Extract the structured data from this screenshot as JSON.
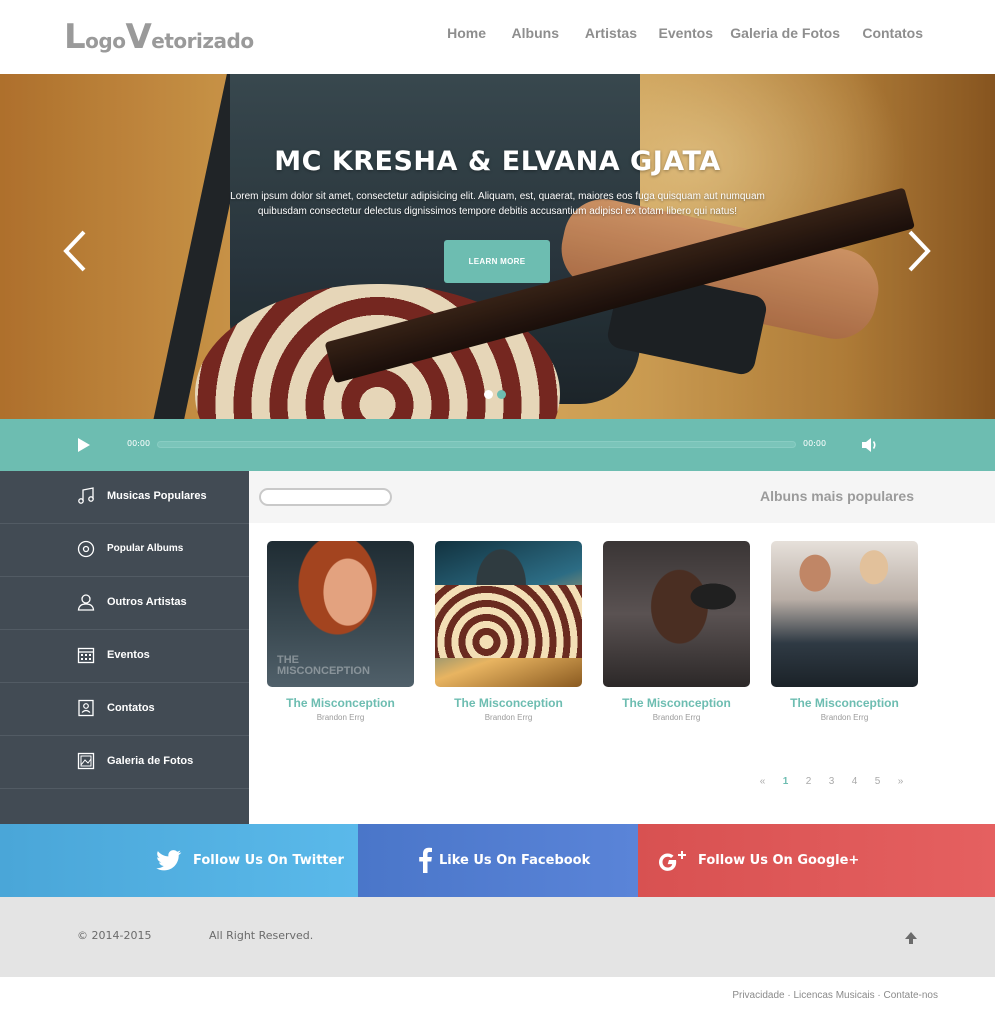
{
  "header": {
    "logo_cap1": "L",
    "logo_rest1": "ogo",
    "logo_cap2": "V",
    "logo_rest2": "etorizado",
    "nav": [
      "Home",
      "Albuns",
      "Artistas",
      "Eventos",
      "Galeria de Fotos",
      "Contatos"
    ]
  },
  "hero": {
    "title": "MC KRESHA & ELVANA GJATA",
    "text": "Lorem ipsum dolor sit amet, consectetur adipisicing elit. Aliquam, est, quaerat, maiores eos fuga quisquam aut numquam quibusdam consectetur delectus dignissimos tempore debitis accusantium adipisci ex totam libero qui natus!",
    "button": "LEARN MORE",
    "slide_count": 2,
    "active_slide": 2
  },
  "player": {
    "current_time": "00:00",
    "total_time": "00:00",
    "progress": 0
  },
  "sidebar": {
    "items": [
      {
        "label": "Musicas Populares",
        "icon": "music-note-icon"
      },
      {
        "label": "Popular Albums",
        "icon": "disc-icon"
      },
      {
        "label": "Outros Artistas",
        "icon": "user-icon"
      },
      {
        "label": "Eventos",
        "icon": "calendar-icon"
      },
      {
        "label": "Contatos",
        "icon": "address-book-icon"
      },
      {
        "label": "Galeria de Fotos",
        "icon": "image-icon"
      }
    ]
  },
  "main": {
    "search_placeholder": "",
    "section_title": "Albuns mais populares",
    "albums": [
      {
        "title": "The Misconception",
        "artist": "Brandon Errg",
        "watermark_line1": "THE",
        "watermark_line2": "MISCONCEPTION"
      },
      {
        "title": "The Misconception",
        "artist": "Brandon Errg"
      },
      {
        "title": "The Misconception",
        "artist": "Brandon Errg"
      },
      {
        "title": "The Misconception",
        "artist": "Brandon Errg"
      }
    ],
    "pagination": {
      "prev": "«",
      "pages": [
        "1",
        "2",
        "3",
        "4",
        "5"
      ],
      "next": "»",
      "active": "1"
    }
  },
  "social": {
    "twitter": "Follow Us On Twitter",
    "facebook": "Like Us On Facebook",
    "google": "Follow Us On Google+"
  },
  "footer": {
    "copyright": "© 2014-2015",
    "rights": "All Right Reserved.",
    "links": [
      "Privacidade",
      "Licencas Musicais",
      "Contate-nos"
    ],
    "separator": " · "
  },
  "colors": {
    "accent": "#6dbdb1",
    "sidebar": "#424b54",
    "twitter": "#55b3e6",
    "facebook": "#5280d4",
    "google": "#e05858",
    "footer": "#e4e4e4"
  }
}
